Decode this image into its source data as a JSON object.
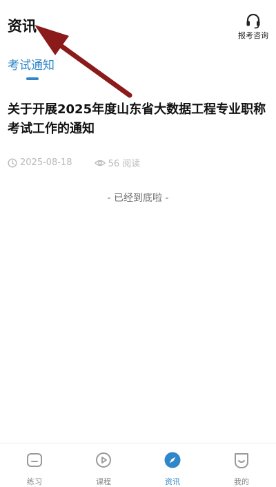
{
  "header": {
    "title": "资讯",
    "consult_label": "报考咨询",
    "consult_icon": "headset-icon"
  },
  "tabs": [
    {
      "label": "考试通知",
      "active": true
    }
  ],
  "article": {
    "title": "关于开展2025年度山东省大数据工程专业职称考试工作的通知",
    "date": "2025-08-18",
    "views": "56 阅读"
  },
  "list_end_text": "- 已经到底啦 -",
  "tabbar": {
    "items": [
      {
        "label": "练习",
        "icon": "practice-icon",
        "active": false
      },
      {
        "label": "课程",
        "icon": "play-icon",
        "active": false
      },
      {
        "label": "资讯",
        "icon": "compass-icon",
        "active": true
      },
      {
        "label": "我的",
        "icon": "profile-icon",
        "active": false
      }
    ]
  },
  "colors": {
    "accent": "#2f86c9",
    "annotation_arrow": "#8b1a1a",
    "muted": "#b9b9b9"
  }
}
